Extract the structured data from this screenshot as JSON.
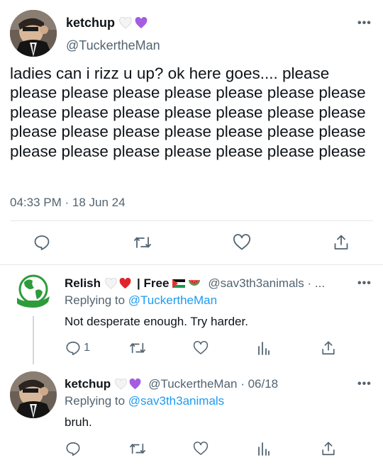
{
  "main_tweet": {
    "display_name": "ketchup",
    "name_emojis": [
      "white-heart",
      "purple-heart"
    ],
    "handle": "@TuckertheMan",
    "text": "ladies can i rizz u up? ok here goes.... please please please please please please please please please please please please please please please please please please please please please please please please please please please please please",
    "timestamp": "04:33 PM · 18 Jun 24",
    "more_label": "•••"
  },
  "replies": [
    {
      "display_name": "Relish",
      "name_suffix": "| Free",
      "name_emojis": [
        "white-heart",
        "red-heart",
        "palestine-flag",
        "watermelon"
      ],
      "handle_date": "@sav3th3animals · ...",
      "replying_prefix": "Replying to",
      "replying_to": "@TuckertheMan",
      "text": "Not desperate enough. Try harder.",
      "reply_count": "1",
      "more_label": "•••"
    },
    {
      "display_name": "ketchup",
      "name_emojis": [
        "white-heart",
        "purple-heart"
      ],
      "handle_date": "@TuckertheMan · 06/18",
      "replying_prefix": "Replying to",
      "replying_to": "@sav3th3animals",
      "text": "bruh.",
      "more_label": "•••"
    }
  ],
  "colors": {
    "text": "#0f1419",
    "muted": "#536471",
    "link": "#1d9bf0",
    "divider": "#e1e8ed",
    "relish_green": "#2e9b3b"
  }
}
